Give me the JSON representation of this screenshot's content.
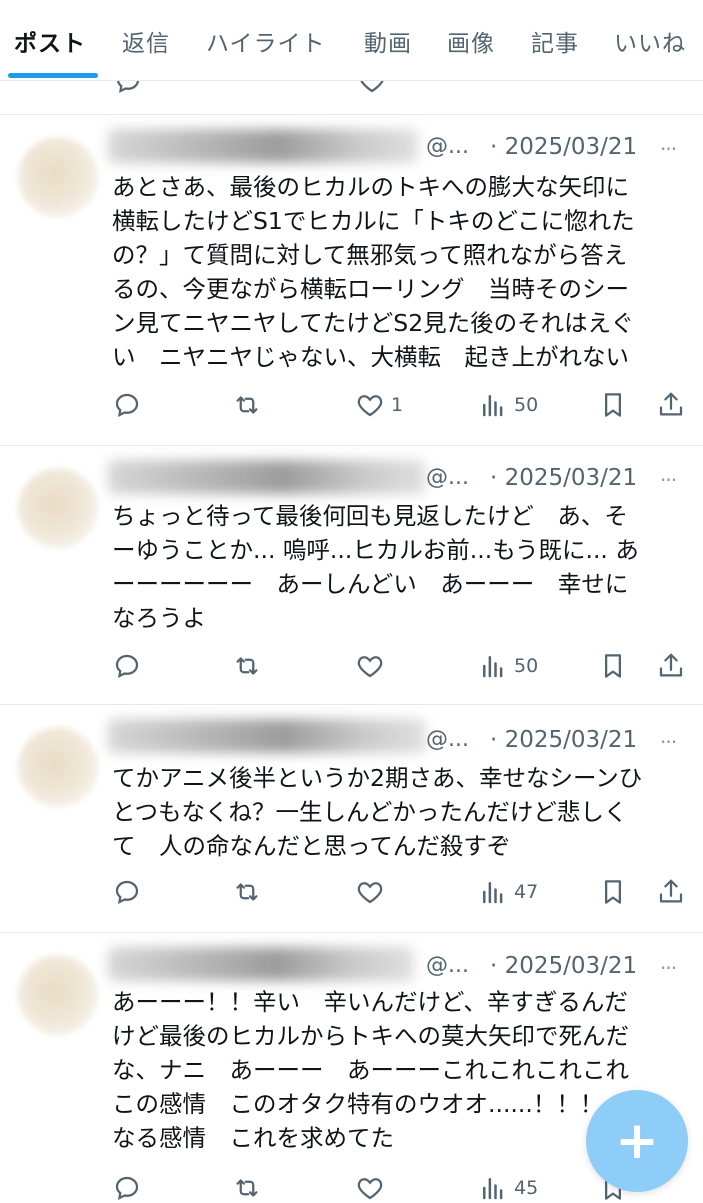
{
  "tabs": [
    {
      "label": "ポスト",
      "active": true
    },
    {
      "label": "返信"
    },
    {
      "label": "ハイライト"
    },
    {
      "label": "動画"
    },
    {
      "label": "画像"
    },
    {
      "label": "記事"
    },
    {
      "label": "いいね"
    }
  ],
  "colors": {
    "accent": "#1d9bf0",
    "muted": "#536471",
    "fab": "#8ecdf7"
  },
  "tweets": [
    {
      "handle": "@...",
      "date": "· 2025/03/21",
      "more": "···",
      "lines": [
        "あとさあ、最後のヒカルのトキへの膨大な矢印に",
        "横転したけどS1でヒカルに「トキのどこに惚れた",
        "の？」て質問に対して無邪気って照れながら答え",
        "るの、今更ながら横転ローリング　当時そのシー",
        "ン見てニヤニヤしてたけどS2見た後のそれはえぐ",
        "い　ニヤニヤじゃない、大横転　起き上がれない"
      ],
      "likes": "1",
      "views": "50"
    },
    {
      "handle": "@...",
      "date": "· 2025/03/21",
      "more": "···",
      "lines": [
        "ちょっと待って最後何回も見返したけど　あ、そ",
        "ーゆうことか... 嗚呼...ヒカルお前...もう既に... あ",
        "ーーーーーー　あーしんどい　あーーー　幸せに",
        "なろうよ"
      ],
      "likes": "",
      "views": "50"
    },
    {
      "handle": "@...",
      "date": "· 2025/03/21",
      "more": "···",
      "lines": [
        "てかアニメ後半というか2期さあ、幸せなシーンひ",
        "とつもなくね？一生しんどかったんだけど悲しく",
        "て　人の命なんだと思ってんだ殺すぞ"
      ],
      "likes": "",
      "views": "47"
    },
    {
      "handle": "@...",
      "date": "· 2025/03/21",
      "more": "···",
      "lines": [
        "あーーー！！辛い　辛いんだけど、辛すぎるんだ",
        "けど最後のヒカルからトキへの莫大矢印で死んだ",
        "な、ナニ　あーーー　あーーーこれこれこれこれ",
        "この感情　このオタク特有のウオオ......！！！って",
        "なる感情　これを求めてた"
      ],
      "likes": "",
      "views": "45"
    }
  ],
  "fab": {
    "label": "+",
    "icon": "compose-plus-icon"
  }
}
